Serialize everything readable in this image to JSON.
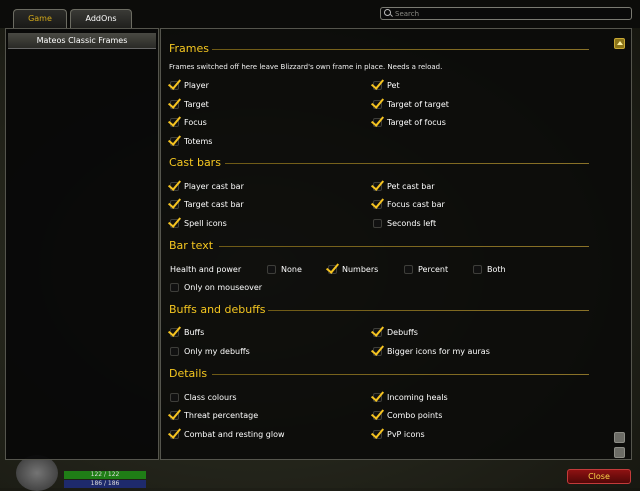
{
  "tabs": [
    {
      "label": "Game",
      "active": false
    },
    {
      "label": "AddOns",
      "active": true
    }
  ],
  "search": {
    "placeholder": "Search",
    "value": ""
  },
  "sidebar": {
    "items": [
      {
        "label": "Mateos Classic Frames",
        "selected": true
      }
    ]
  },
  "unit_frame": {
    "health_text": "122 / 122",
    "mana_text": "186 / 186"
  },
  "close_button": {
    "label": "Close"
  },
  "sections": {
    "frames": {
      "title": "Frames",
      "description": "Frames switched off here leave Blizzard's own frame in place. Needs a reload.",
      "options": {
        "player": {
          "label": "Player",
          "checked": true
        },
        "pet": {
          "label": "Pet",
          "checked": true
        },
        "target": {
          "label": "Target",
          "checked": true
        },
        "target_of_target": {
          "label": "Target of target",
          "checked": true
        },
        "focus": {
          "label": "Focus",
          "checked": true
        },
        "target_of_focus": {
          "label": "Target of focus",
          "checked": true
        },
        "totems": {
          "label": "Totems",
          "checked": true
        }
      }
    },
    "cast_bars": {
      "title": "Cast bars",
      "options": {
        "player_cast_bar": {
          "label": "Player cast bar",
          "checked": true
        },
        "pet_cast_bar": {
          "label": "Pet cast bar",
          "checked": true
        },
        "target_cast_bar": {
          "label": "Target cast bar",
          "checked": true
        },
        "focus_cast_bar": {
          "label": "Focus cast bar",
          "checked": true
        },
        "spell_icons": {
          "label": "Spell icons",
          "checked": true
        },
        "seconds_left": {
          "label": "Seconds left",
          "checked": false
        }
      }
    },
    "bar_text": {
      "title": "Bar text",
      "health_and_power_label": "Health and power",
      "options": {
        "none": {
          "label": "None",
          "checked": false
        },
        "numbers": {
          "label": "Numbers",
          "checked": true
        },
        "percent": {
          "label": "Percent",
          "checked": false
        },
        "both": {
          "label": "Both",
          "checked": false
        },
        "only_on_mouseover": {
          "label": "Only on mouseover",
          "checked": false
        }
      }
    },
    "buffs": {
      "title": "Buffs and debuffs",
      "options": {
        "buffs": {
          "label": "Buffs",
          "checked": true
        },
        "debuffs": {
          "label": "Debuffs",
          "checked": true
        },
        "only_my_debuffs": {
          "label": "Only my debuffs",
          "checked": false
        },
        "bigger_icons": {
          "label": "Bigger icons for my auras",
          "checked": true
        }
      }
    },
    "details": {
      "title": "Details",
      "options": {
        "class_colours": {
          "label": "Class colours",
          "checked": false
        },
        "incoming_heals": {
          "label": "Incoming heals",
          "checked": true
        },
        "threat_percentage": {
          "label": "Threat percentage",
          "checked": true
        },
        "combo_points": {
          "label": "Combo points",
          "checked": true
        },
        "combat_resting_glow": {
          "label": "Combat and resting glow",
          "checked": true
        },
        "pvp_icons": {
          "label": "PvP icons",
          "checked": true
        }
      }
    }
  }
}
